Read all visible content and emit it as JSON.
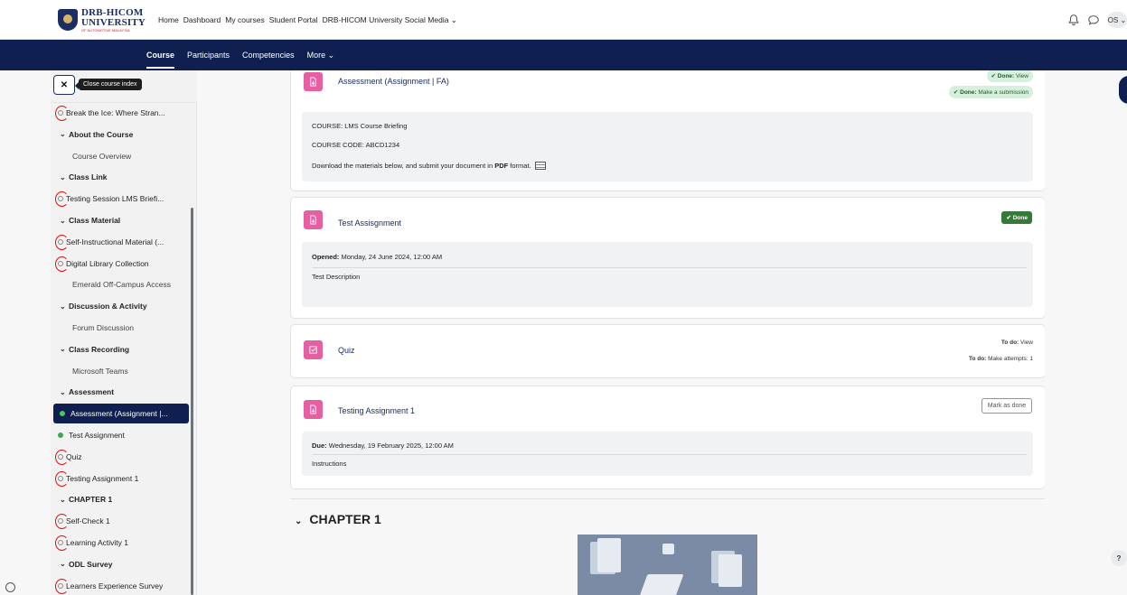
{
  "brand": {
    "logo_line1": "DRB-HICOM",
    "logo_line2": "UNIVERSITY",
    "logo_line3": "OF AUTOMOTIVE MALAYSIA",
    "navy": "#0f2050",
    "activity_pink": "#e75fa3",
    "done_green": "#357a38"
  },
  "topnav": {
    "items": [
      "Home",
      "Dashboard",
      "My courses",
      "Student Portal",
      "DRB-HICOM University Social Media ⌄"
    ],
    "avatar": "OS ⌄"
  },
  "secondary_nav": {
    "items": [
      "Course",
      "Participants",
      "Competencies",
      "More ⌄"
    ]
  },
  "course_index": {
    "close_tooltip": "Close course index",
    "items": [
      {
        "type": "activity-marked",
        "label": "Break the Ice: Where Stran..."
      },
      {
        "type": "section",
        "label": "About the Course"
      },
      {
        "type": "activity",
        "label": "Course Overview"
      },
      {
        "type": "section",
        "label": "Class Link"
      },
      {
        "type": "activity-marked",
        "label": "Testing Session LMS Briefi..."
      },
      {
        "type": "section",
        "label": "Class Material"
      },
      {
        "type": "activity-marked",
        "label": "Self-Instructional Material (..."
      },
      {
        "type": "activity-marked",
        "label": "Digital Library Collection"
      },
      {
        "type": "activity",
        "label": "Emerald Off-Campus Access"
      },
      {
        "type": "section",
        "label": "Discussion & Activity"
      },
      {
        "type": "activity",
        "label": "Forum Discussion"
      },
      {
        "type": "section",
        "label": "Class Recording"
      },
      {
        "type": "activity",
        "label": "Microsoft Teams"
      },
      {
        "type": "section",
        "label": "Assessment"
      },
      {
        "type": "current",
        "label": "Assessment (Assignment |..."
      },
      {
        "type": "done",
        "label": "Test Assignment"
      },
      {
        "type": "activity-marked",
        "label": "Quiz"
      },
      {
        "type": "activity-marked",
        "label": "Testing Assignment 1"
      },
      {
        "type": "section",
        "label": "CHAPTER 1"
      },
      {
        "type": "activity-marked",
        "label": "Self-Check 1"
      },
      {
        "type": "activity-marked",
        "label": "Learning Activity 1"
      },
      {
        "type": "section",
        "label": "ODL Survey"
      },
      {
        "type": "activity-marked",
        "label": "Learners Experience Survey"
      }
    ]
  },
  "activities": {
    "a1": {
      "title": "Assessment (Assignment | FA)",
      "badge1_key": "Done:",
      "badge1_val": "View",
      "badge2_key": "Done:",
      "badge2_val": "Make a submission",
      "desc_course": "COURSE: LMS Course Briefing",
      "desc_code": "COURSE CODE: ABCD1234",
      "desc_download_pre": "Download the materials below, and submit your document in ",
      "desc_download_bold": "PDF",
      "desc_download_post": " format."
    },
    "a2": {
      "title": "Test Assisgnment",
      "badge": "✔ Done",
      "opened_key": "Opened:",
      "opened_val": "Monday, 24 June 2024, 12:00 AM",
      "description": "Test Description"
    },
    "a3": {
      "title": "Quiz",
      "todo1_key": "To do:",
      "todo1_val": "View",
      "todo2_key": "To do:",
      "todo2_val": "Make attempts: 1"
    },
    "a4": {
      "title": "Testing Assignment 1",
      "button": "Mark as done",
      "due_key": "Due:",
      "due_val": "Wednesday, 19 February 2025, 12:00 AM",
      "instructions": "Instructions"
    }
  },
  "chapter": {
    "title": "CHAPTER 1"
  },
  "help": "?"
}
